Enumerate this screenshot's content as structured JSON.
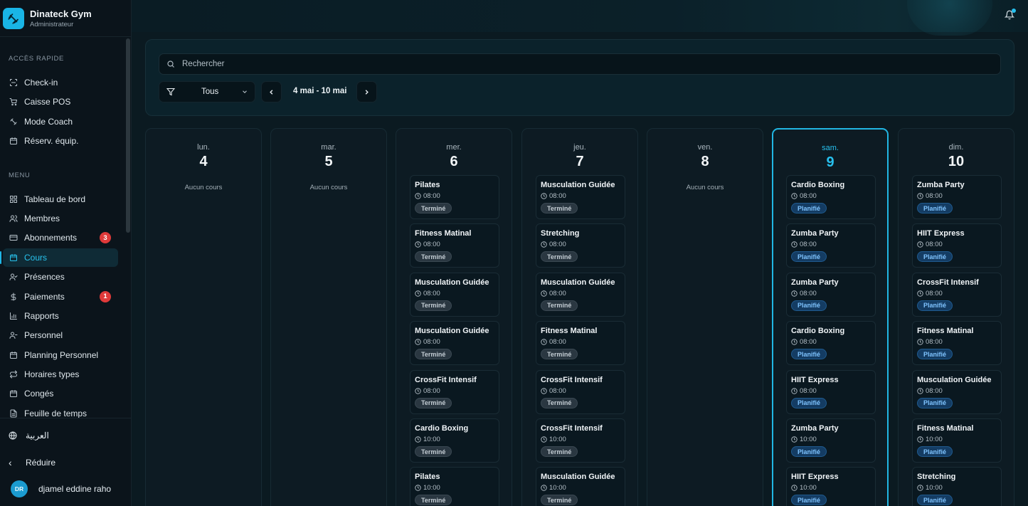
{
  "brand": {
    "name": "Dinateck Gym",
    "role": "Administrateur"
  },
  "quick_access": {
    "label": "ACCÈS RAPIDE",
    "items": [
      {
        "label": "Check-in",
        "icon": "scan-icon"
      },
      {
        "label": "Caisse POS",
        "icon": "cart-icon"
      },
      {
        "label": "Mode Coach",
        "icon": "dumbbell-icon"
      },
      {
        "label": "Réserv. équip.",
        "icon": "calendar-clock-icon"
      }
    ]
  },
  "menu": {
    "label": "MENU",
    "items": [
      {
        "label": "Tableau de bord",
        "icon": "grid-icon"
      },
      {
        "label": "Membres",
        "icon": "users-icon"
      },
      {
        "label": "Abonnements",
        "icon": "card-icon",
        "badge": "3"
      },
      {
        "label": "Cours",
        "icon": "calendar-icon",
        "active": true
      },
      {
        "label": "Présences",
        "icon": "user-check-icon"
      },
      {
        "label": "Paiements",
        "icon": "dollar-icon",
        "badge": "1"
      },
      {
        "label": "Rapports",
        "icon": "bar-chart-icon"
      },
      {
        "label": "Personnel",
        "icon": "staff-icon"
      },
      {
        "label": "Planning Personnel",
        "icon": "calendar-icon"
      },
      {
        "label": "Horaires types",
        "icon": "repeat-icon"
      },
      {
        "label": "Congés",
        "icon": "calendar-icon"
      },
      {
        "label": "Feuille de temps",
        "icon": "file-icon"
      }
    ]
  },
  "footer": {
    "language": "العربية",
    "collapse": "Réduire",
    "user_initials": "DR",
    "user_name": "djamel eddine raho"
  },
  "search": {
    "placeholder": "Rechercher"
  },
  "filter": {
    "value": "Tous"
  },
  "week_range": "4 mai - 10 mai",
  "colors": {
    "accent": "#21b6e3",
    "done": "#2a3741",
    "planned": "#143c63",
    "badge": "#e03a3a"
  },
  "days": [
    {
      "name": "lun.",
      "num": "4",
      "empty": "Aucun cours",
      "courses": []
    },
    {
      "name": "mar.",
      "num": "5",
      "empty": "Aucun cours",
      "courses": []
    },
    {
      "name": "mer.",
      "num": "6",
      "courses": [
        {
          "title": "Pilates",
          "time": "08:00",
          "status": "Terminé"
        },
        {
          "title": "Fitness Matinal",
          "time": "08:00",
          "status": "Terminé"
        },
        {
          "title": "Musculation Guidée",
          "time": "08:00",
          "status": "Terminé"
        },
        {
          "title": "Musculation Guidée",
          "time": "08:00",
          "status": "Terminé"
        },
        {
          "title": "CrossFit Intensif",
          "time": "08:00",
          "status": "Terminé"
        },
        {
          "title": "Cardio Boxing",
          "time": "10:00",
          "status": "Terminé"
        },
        {
          "title": "Pilates",
          "time": "10:00",
          "status": "Terminé"
        }
      ]
    },
    {
      "name": "jeu.",
      "num": "7",
      "courses": [
        {
          "title": "Musculation Guidée",
          "time": "08:00",
          "status": "Terminé"
        },
        {
          "title": "Stretching",
          "time": "08:00",
          "status": "Terminé"
        },
        {
          "title": "Musculation Guidée",
          "time": "08:00",
          "status": "Terminé"
        },
        {
          "title": "Fitness Matinal",
          "time": "08:00",
          "status": "Terminé"
        },
        {
          "title": "CrossFit Intensif",
          "time": "08:00",
          "status": "Terminé"
        },
        {
          "title": "CrossFit Intensif",
          "time": "10:00",
          "status": "Terminé"
        },
        {
          "title": "Musculation Guidée",
          "time": "10:00",
          "status": "Terminé"
        }
      ]
    },
    {
      "name": "ven.",
      "num": "8",
      "empty": "Aucun cours",
      "courses": []
    },
    {
      "name": "sam.",
      "num": "9",
      "today": true,
      "courses": [
        {
          "title": "Cardio Boxing",
          "time": "08:00",
          "status": "Planifié"
        },
        {
          "title": "Zumba Party",
          "time": "08:00",
          "status": "Planifié"
        },
        {
          "title": "Zumba Party",
          "time": "08:00",
          "status": "Planifié"
        },
        {
          "title": "Cardio Boxing",
          "time": "08:00",
          "status": "Planifié"
        },
        {
          "title": "HIIT Express",
          "time": "08:00",
          "status": "Planifié"
        },
        {
          "title": "Zumba Party",
          "time": "10:00",
          "status": "Planifié"
        },
        {
          "title": "HIIT Express",
          "time": "10:00",
          "status": "Planifié"
        }
      ]
    },
    {
      "name": "dim.",
      "num": "10",
      "courses": [
        {
          "title": "Zumba Party",
          "time": "08:00",
          "status": "Planifié"
        },
        {
          "title": "HIIT Express",
          "time": "08:00",
          "status": "Planifié"
        },
        {
          "title": "CrossFit Intensif",
          "time": "08:00",
          "status": "Planifié"
        },
        {
          "title": "Fitness Matinal",
          "time": "08:00",
          "status": "Planifié"
        },
        {
          "title": "Musculation Guidée",
          "time": "08:00",
          "status": "Planifié"
        },
        {
          "title": "Fitness Matinal",
          "time": "10:00",
          "status": "Planifié"
        },
        {
          "title": "Stretching",
          "time": "10:00",
          "status": "Planifié"
        }
      ]
    }
  ]
}
